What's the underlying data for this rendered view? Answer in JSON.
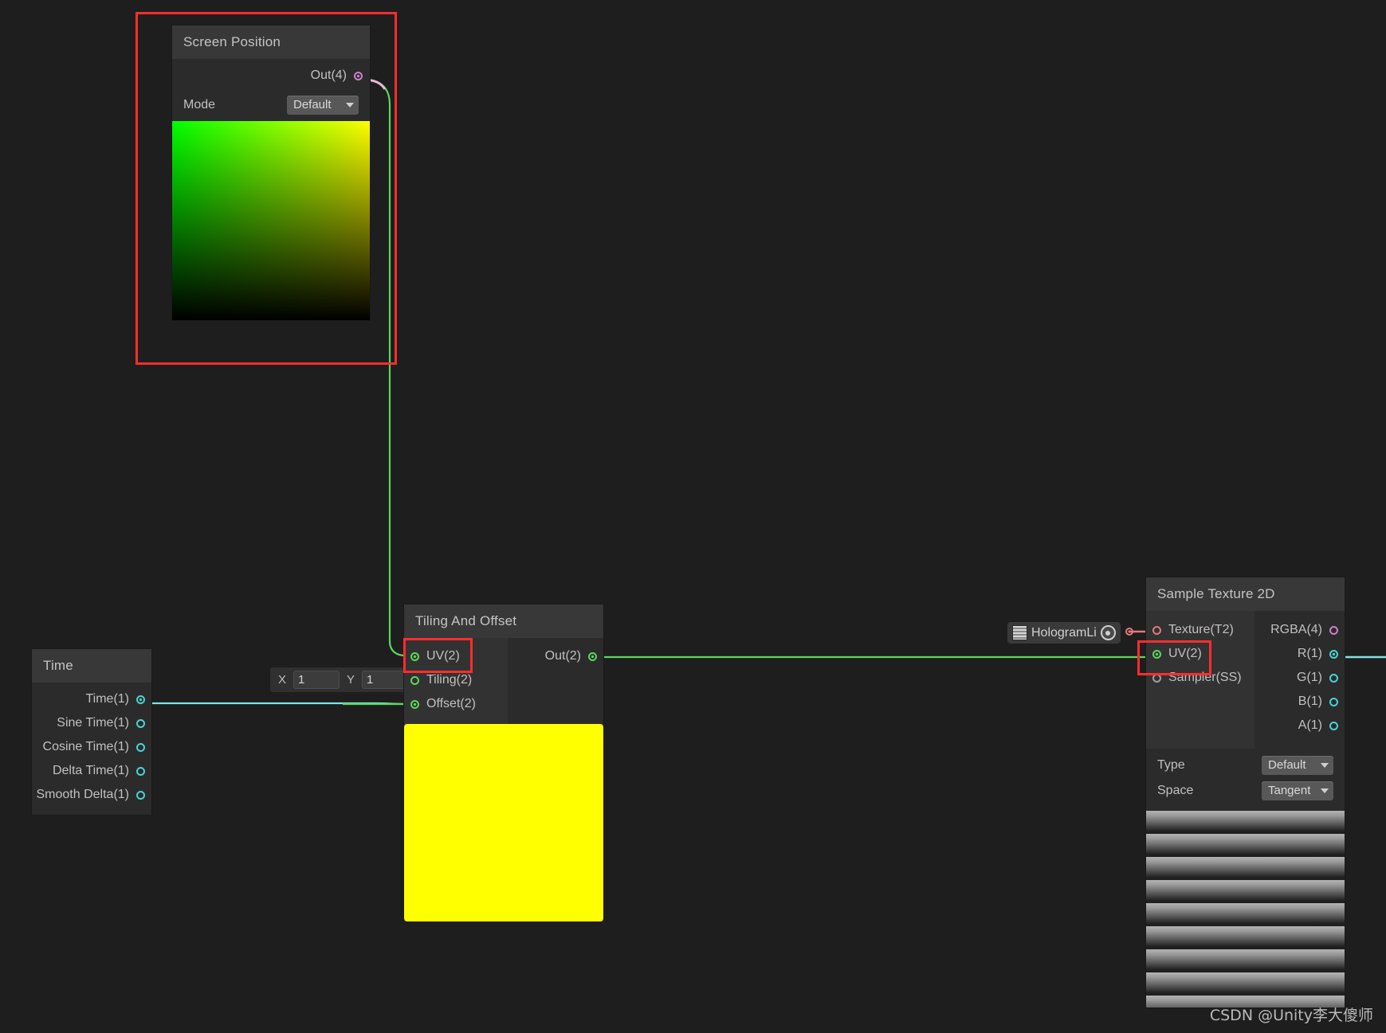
{
  "app": {
    "name": "Unity Shader Graph",
    "canvas_background": "#1e1e1e"
  },
  "watermark": {
    "text": "CSDN @Unity李大傻师"
  },
  "colors": {
    "annotation": "#ff2d2d",
    "wire_green": "#5bd75b",
    "wire_cyan": "#7fe3e3",
    "wire_pink": "#e0a8c8",
    "wire_red": "#e07a7a",
    "node_header": "#383838",
    "node_body": "#2b2b2b"
  },
  "nodes": {
    "screen_position": {
      "title": "Screen Position",
      "outputs": [
        {
          "label": "Out(4)",
          "type": "v4",
          "connected": true
        }
      ],
      "properties": [
        {
          "label": "Mode",
          "value": "Default"
        }
      ],
      "preview": "gradient-uv"
    },
    "time": {
      "title": "Time",
      "outputs": [
        {
          "label": "Time(1)",
          "type": "v1",
          "connected": true
        },
        {
          "label": "Sine Time(1)",
          "type": "v1",
          "connected": false
        },
        {
          "label": "Cosine Time(1)",
          "type": "v1",
          "connected": false
        },
        {
          "label": "Delta Time(1)",
          "type": "v1",
          "connected": false
        },
        {
          "label": "Smooth Delta(1)",
          "type": "v1",
          "connected": false
        }
      ]
    },
    "tiling_and_offset": {
      "title": "Tiling And Offset",
      "inputs": [
        {
          "label": "UV(2)",
          "type": "v2",
          "connected": true,
          "highlighted": true
        },
        {
          "label": "Tiling(2)",
          "type": "v2",
          "connected": false,
          "highlighted": false
        },
        {
          "label": "Offset(2)",
          "type": "v2",
          "connected": true,
          "highlighted": false
        }
      ],
      "outputs": [
        {
          "label": "Out(2)",
          "type": "v2",
          "connected": true
        }
      ],
      "preview": "solid-yellow",
      "tiling_field": {
        "x_label": "X",
        "x_value": "1",
        "y_label": "Y",
        "y_value": "1"
      }
    },
    "texture_property": {
      "label": "HologramLi",
      "swatch": "texture-stripes-icon"
    },
    "sample_texture_2d": {
      "title": "Sample Texture 2D",
      "inputs": [
        {
          "label": "Texture(T2)",
          "type": "tex",
          "connected": true,
          "highlighted": false
        },
        {
          "label": "UV(2)",
          "type": "v2",
          "connected": true,
          "highlighted": true
        },
        {
          "label": "Sampler(SS)",
          "type": "samp",
          "connected": false,
          "highlighted": false
        }
      ],
      "outputs": [
        {
          "label": "RGBA(4)",
          "type": "v4",
          "connected": false
        },
        {
          "label": "R(1)",
          "type": "v1",
          "connected": true
        },
        {
          "label": "G(1)",
          "type": "v1",
          "connected": false
        },
        {
          "label": "B(1)",
          "type": "v1",
          "connected": false
        },
        {
          "label": "A(1)",
          "type": "v1",
          "connected": false
        }
      ],
      "properties": [
        {
          "label": "Type",
          "value": "Default"
        },
        {
          "label": "Space",
          "value": "Tangent"
        }
      ],
      "preview": "horizontal-stripes"
    }
  },
  "annotations": [
    {
      "name": "screen-position-highlight"
    },
    {
      "name": "tiling-offset-uv-highlight"
    },
    {
      "name": "sample-texture-uv-highlight"
    }
  ]
}
